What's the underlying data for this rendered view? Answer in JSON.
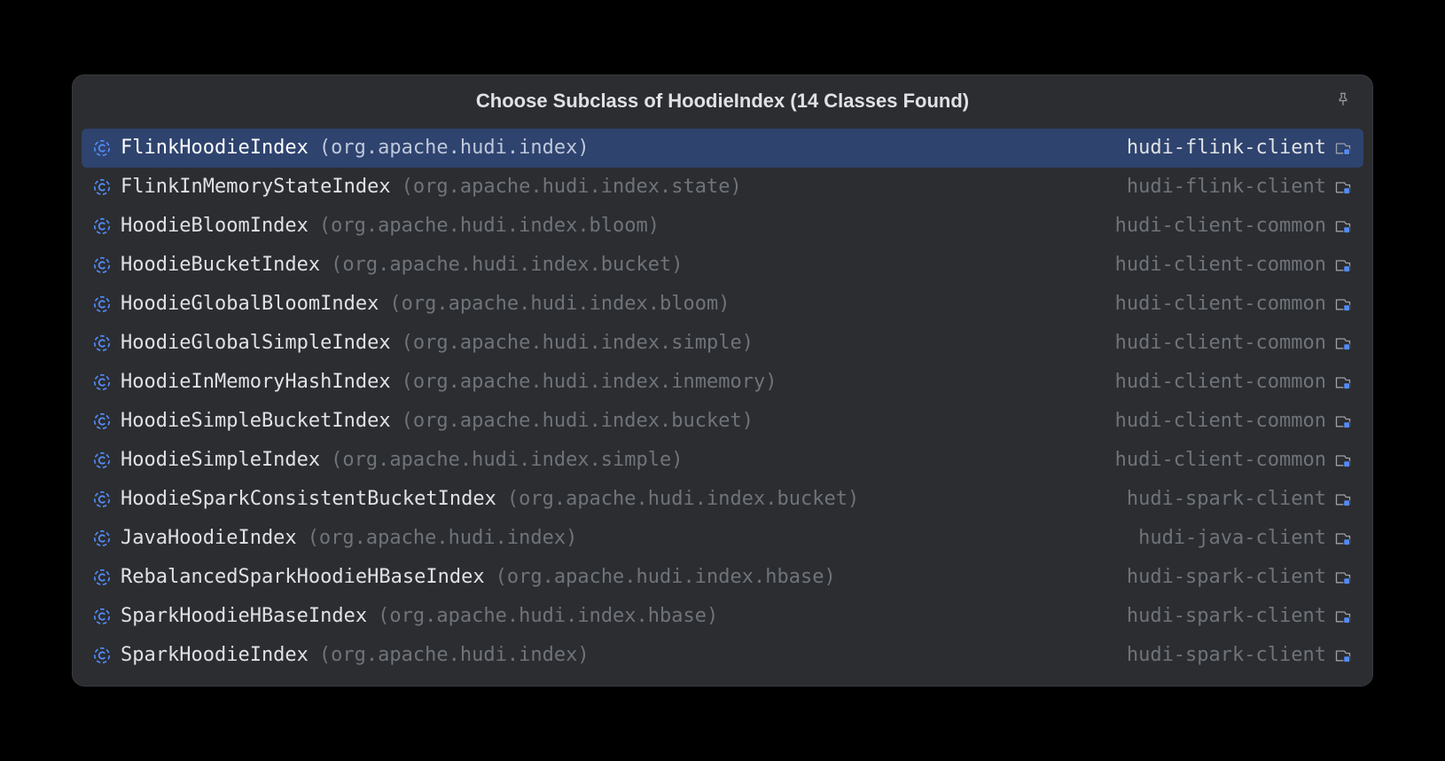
{
  "title": "Choose Subclass of HoodieIndex (14 Classes Found)",
  "items": [
    {
      "name": "FlinkHoodieIndex",
      "package": "org.apache.hudi.index",
      "module": "hudi-flink-client",
      "selected": true
    },
    {
      "name": "FlinkInMemoryStateIndex",
      "package": "org.apache.hudi.index.state",
      "module": "hudi-flink-client",
      "selected": false
    },
    {
      "name": "HoodieBloomIndex",
      "package": "org.apache.hudi.index.bloom",
      "module": "hudi-client-common",
      "selected": false
    },
    {
      "name": "HoodieBucketIndex",
      "package": "org.apache.hudi.index.bucket",
      "module": "hudi-client-common",
      "selected": false
    },
    {
      "name": "HoodieGlobalBloomIndex",
      "package": "org.apache.hudi.index.bloom",
      "module": "hudi-client-common",
      "selected": false
    },
    {
      "name": "HoodieGlobalSimpleIndex",
      "package": "org.apache.hudi.index.simple",
      "module": "hudi-client-common",
      "selected": false
    },
    {
      "name": "HoodieInMemoryHashIndex",
      "package": "org.apache.hudi.index.inmemory",
      "module": "hudi-client-common",
      "selected": false
    },
    {
      "name": "HoodieSimpleBucketIndex",
      "package": "org.apache.hudi.index.bucket",
      "module": "hudi-client-common",
      "selected": false
    },
    {
      "name": "HoodieSimpleIndex",
      "package": "org.apache.hudi.index.simple",
      "module": "hudi-client-common",
      "selected": false
    },
    {
      "name": "HoodieSparkConsistentBucketIndex",
      "package": "org.apache.hudi.index.bucket",
      "module": "hudi-spark-client",
      "selected": false
    },
    {
      "name": "JavaHoodieIndex",
      "package": "org.apache.hudi.index",
      "module": "hudi-java-client",
      "selected": false
    },
    {
      "name": "RebalancedSparkHoodieHBaseIndex",
      "package": "org.apache.hudi.index.hbase",
      "module": "hudi-spark-client",
      "selected": false
    },
    {
      "name": "SparkHoodieHBaseIndex",
      "package": "org.apache.hudi.index.hbase",
      "module": "hudi-spark-client",
      "selected": false
    },
    {
      "name": "SparkHoodieIndex",
      "package": "org.apache.hudi.index",
      "module": "hudi-spark-client",
      "selected": false
    }
  ]
}
